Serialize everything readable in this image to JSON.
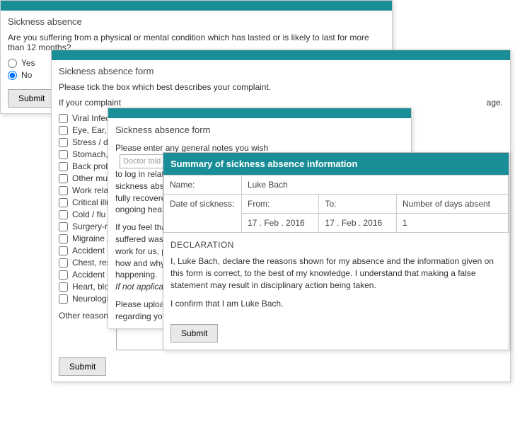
{
  "w1": {
    "title": "Sickness absence",
    "question": "Are you suffering from a physical or mental condition which has lasted or is likely to last for more than 12 months?",
    "yes": "Yes",
    "no": "No",
    "submit": "Submit"
  },
  "w2": {
    "title": "Sickness absence form",
    "instruction": "Please tick the box which best describes your complaint.",
    "note": "If your complaint",
    "note_suffix": "age.",
    "items": [
      "Viral Infection",
      "Eye, Ear, Nos",
      "Stress / dep",
      "Stomach, liv",
      "Back problem",
      "Other muscu",
      "Work related",
      "Critical illne",
      "Cold / flu (e",
      "Surgery-rela",
      "Migraine / h",
      "Accident at",
      "Chest, respi",
      "Accident outside work",
      "Heart, blood pressure, circulation",
      "Neurological illness (inc. epilep"
    ],
    "other_label": "Other reason:",
    "submit": "Submit"
  },
  "w3": {
    "title": "Sickness absence form",
    "line1": "Please enter any general notes you wish",
    "placeholder": "Doctor told me to keep an eye on it but I'm",
    "line2": "to log in relation t",
    "line3": "sickness absence f",
    "line4": "fully recovered or",
    "line5": "ongoing health pr",
    "line6": "If you feel that the",
    "line7": "suffered was caus",
    "line8": "work for us, p",
    "line9": "how and why you",
    "line10": "happening.",
    "italic": "If not applicable, p",
    "line11": "Please upload any",
    "line12": "regarding your sic"
  },
  "w4": {
    "header": "Summary of sickness absence information",
    "name_label": "Name:",
    "name_value": "Luke Bach",
    "date_label": "Date of sickness:",
    "from_label": "From:",
    "to_label": "To:",
    "days_label": "Number of days absent",
    "from_value": "17 . Feb . 2016",
    "to_value": "17 . Feb . 2016",
    "days_value": "1",
    "decl_title": "DECLARATION",
    "decl_text": "I, Luke Bach, declare the reasons shown for my absence and the information given on this form is correct, to the best of my knowledge. I understand that making a false statement may result in disciplinary action being taken.",
    "confirm": "I confirm that I am Luke Bach.",
    "submit": "Submit"
  }
}
